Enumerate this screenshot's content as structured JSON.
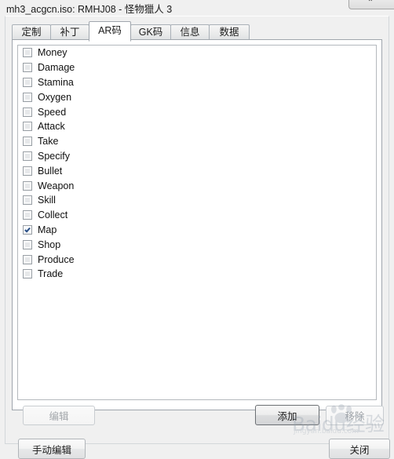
{
  "window": {
    "title": "mh3_acgcn.iso: RMHJ08 - 怪物獵人 3",
    "control_glyph": "⌃",
    "control_name": "restore-button"
  },
  "tabs": [
    {
      "label": "定制",
      "name": "tab-custom",
      "active": false
    },
    {
      "label": "补丁",
      "name": "tab-patch",
      "active": false
    },
    {
      "label": "AR码",
      "name": "tab-ar-code",
      "active": true
    },
    {
      "label": "GK码",
      "name": "tab-gk-code",
      "active": false
    },
    {
      "label": "信息",
      "name": "tab-info",
      "active": false
    },
    {
      "label": "数据",
      "name": "tab-data",
      "active": false
    }
  ],
  "list": {
    "items": [
      {
        "label": "Money",
        "checked": false
      },
      {
        "label": "Damage",
        "checked": false
      },
      {
        "label": "Stamina",
        "checked": false
      },
      {
        "label": "Oxygen",
        "checked": false
      },
      {
        "label": "Speed",
        "checked": false
      },
      {
        "label": "Attack",
        "checked": false
      },
      {
        "label": "Take",
        "checked": false
      },
      {
        "label": "Specify",
        "checked": false
      },
      {
        "label": "Bullet",
        "checked": false
      },
      {
        "label": "Weapon",
        "checked": false
      },
      {
        "label": "Skill",
        "checked": false
      },
      {
        "label": "Collect",
        "checked": false
      },
      {
        "label": "Map",
        "checked": true
      },
      {
        "label": "Shop",
        "checked": false
      },
      {
        "label": "Produce",
        "checked": false
      },
      {
        "label": "Trade",
        "checked": false
      }
    ]
  },
  "buttons": {
    "edit": {
      "label": "编辑",
      "enabled": false,
      "default": false
    },
    "add": {
      "label": "添加",
      "enabled": true,
      "default": true
    },
    "remove": {
      "label": "移除",
      "enabled": false,
      "default": false
    },
    "manual": {
      "label": "手动编辑",
      "enabled": true,
      "default": false
    },
    "close": {
      "label": "关闭",
      "enabled": true,
      "default": false
    }
  },
  "watermark": {
    "main": "Baidu经验",
    "sub": "jingyan.baidu.com"
  },
  "colors": {
    "accent": "#2a4f86",
    "window_bg": "#f0f0f0",
    "panel_bg": "#ffffff",
    "border": "#a0a6ad"
  }
}
